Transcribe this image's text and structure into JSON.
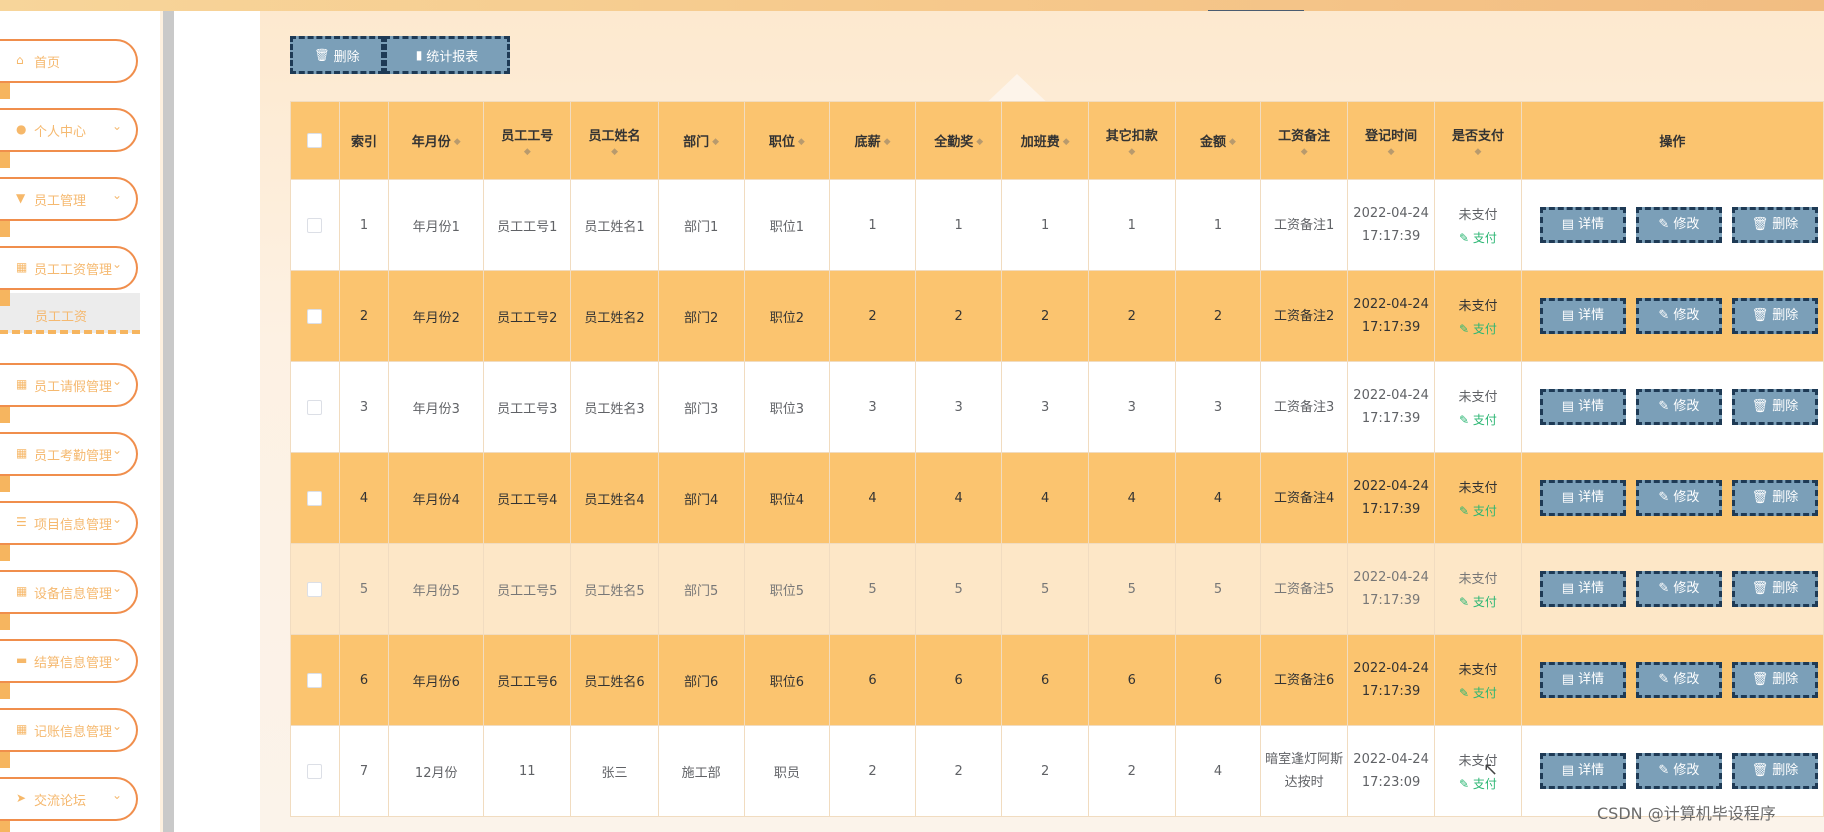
{
  "sidebar": {
    "items": [
      {
        "label": "首页",
        "icon": "home-icon",
        "glyph": "⌂",
        "chevron": false
      },
      {
        "label": "个人中心",
        "icon": "user-icon",
        "glyph": "●",
        "chevron": true
      },
      {
        "label": "员工管理",
        "icon": "flag-icon",
        "glyph": "▼",
        "chevron": true
      },
      {
        "label": "员工工资管理",
        "icon": "grid-icon",
        "glyph": "▦",
        "chevron": true
      },
      {
        "label": "员工请假管理",
        "icon": "grid-icon",
        "glyph": "▦",
        "chevron": true
      },
      {
        "label": "员工考勤管理",
        "icon": "grid-icon",
        "glyph": "▦",
        "chevron": true
      },
      {
        "label": "项目信息管理",
        "icon": "list-icon",
        "glyph": "☰",
        "chevron": true
      },
      {
        "label": "设备信息管理",
        "icon": "grid-icon",
        "glyph": "▦",
        "chevron": true
      },
      {
        "label": "结算信息管理",
        "icon": "briefcase-icon",
        "glyph": "▬",
        "chevron": true
      },
      {
        "label": "记账信息管理",
        "icon": "grid-icon",
        "glyph": "▦",
        "chevron": true
      },
      {
        "label": "交流论坛",
        "icon": "send-icon",
        "glyph": "➤",
        "chevron": true
      }
    ],
    "submenu_label": "员工工资"
  },
  "toolbar": {
    "delete_label": "删除",
    "report_label": "统计报表"
  },
  "table": {
    "headers": {
      "index": "索引",
      "month": "年月份",
      "emp_no": "员工工号",
      "emp_name": "员工姓名",
      "dept": "部门",
      "position": "职位",
      "base": "底薪",
      "bonus": "全勤奖",
      "overtime": "加班费",
      "deduction": "其它扣款",
      "amount": "金额",
      "remark": "工资备注",
      "reg_time": "登记时间",
      "paid": "是否支付",
      "actions": "操作"
    },
    "pay_action": "支付",
    "actions": {
      "detail": "详情",
      "edit": "修改",
      "delete": "删除"
    },
    "rows": [
      {
        "index": "1",
        "month": "年月份1",
        "emp_no": "员工工号1",
        "emp_name": "员工姓名1",
        "dept": "部门1",
        "position": "职位1",
        "base": "1",
        "bonus": "1",
        "overtime": "1",
        "deduction": "1",
        "amount": "1",
        "remark": "工资备注1",
        "time": "2022-04-24 17:17:39",
        "paid": "未支付"
      },
      {
        "index": "2",
        "month": "年月份2",
        "emp_no": "员工工号2",
        "emp_name": "员工姓名2",
        "dept": "部门2",
        "position": "职位2",
        "base": "2",
        "bonus": "2",
        "overtime": "2",
        "deduction": "2",
        "amount": "2",
        "remark": "工资备注2",
        "time": "2022-04-24 17:17:39",
        "paid": "未支付"
      },
      {
        "index": "3",
        "month": "年月份3",
        "emp_no": "员工工号3",
        "emp_name": "员工姓名3",
        "dept": "部门3",
        "position": "职位3",
        "base": "3",
        "bonus": "3",
        "overtime": "3",
        "deduction": "3",
        "amount": "3",
        "remark": "工资备注3",
        "time": "2022-04-24 17:17:39",
        "paid": "未支付"
      },
      {
        "index": "4",
        "month": "年月份4",
        "emp_no": "员工工号4",
        "emp_name": "员工姓名4",
        "dept": "部门4",
        "position": "职位4",
        "base": "4",
        "bonus": "4",
        "overtime": "4",
        "deduction": "4",
        "amount": "4",
        "remark": "工资备注4",
        "time": "2022-04-24 17:17:39",
        "paid": "未支付"
      },
      {
        "index": "5",
        "month": "年月份5",
        "emp_no": "员工工号5",
        "emp_name": "员工姓名5",
        "dept": "部门5",
        "position": "职位5",
        "base": "5",
        "bonus": "5",
        "overtime": "5",
        "deduction": "5",
        "amount": "5",
        "remark": "工资备注5",
        "time": "2022-04-24 17:17:39",
        "paid": "未支付"
      },
      {
        "index": "6",
        "month": "年月份6",
        "emp_no": "员工工号6",
        "emp_name": "员工姓名6",
        "dept": "部门6",
        "position": "职位6",
        "base": "6",
        "bonus": "6",
        "overtime": "6",
        "deduction": "6",
        "amount": "6",
        "remark": "工资备注6",
        "time": "2022-04-24 17:17:39",
        "paid": "未支付"
      },
      {
        "index": "7",
        "month": "12月份",
        "emp_no": "11",
        "emp_name": "张三",
        "dept": "施工部",
        "position": "职员",
        "base": "2",
        "bonus": "2",
        "overtime": "2",
        "deduction": "2",
        "amount": "4",
        "remark": "暗室逢灯阿斯达按时",
        "time": "2022-04-24 17:23:09",
        "paid": "未支付"
      }
    ]
  },
  "watermark": "CSDN @计算机毕设程序",
  "colors": {
    "accent": "#fbc46f",
    "button": "#7b9fb8",
    "button_border": "#1e3a55",
    "menu_border": "#f08e4c",
    "pay_link": "#2bb673"
  }
}
